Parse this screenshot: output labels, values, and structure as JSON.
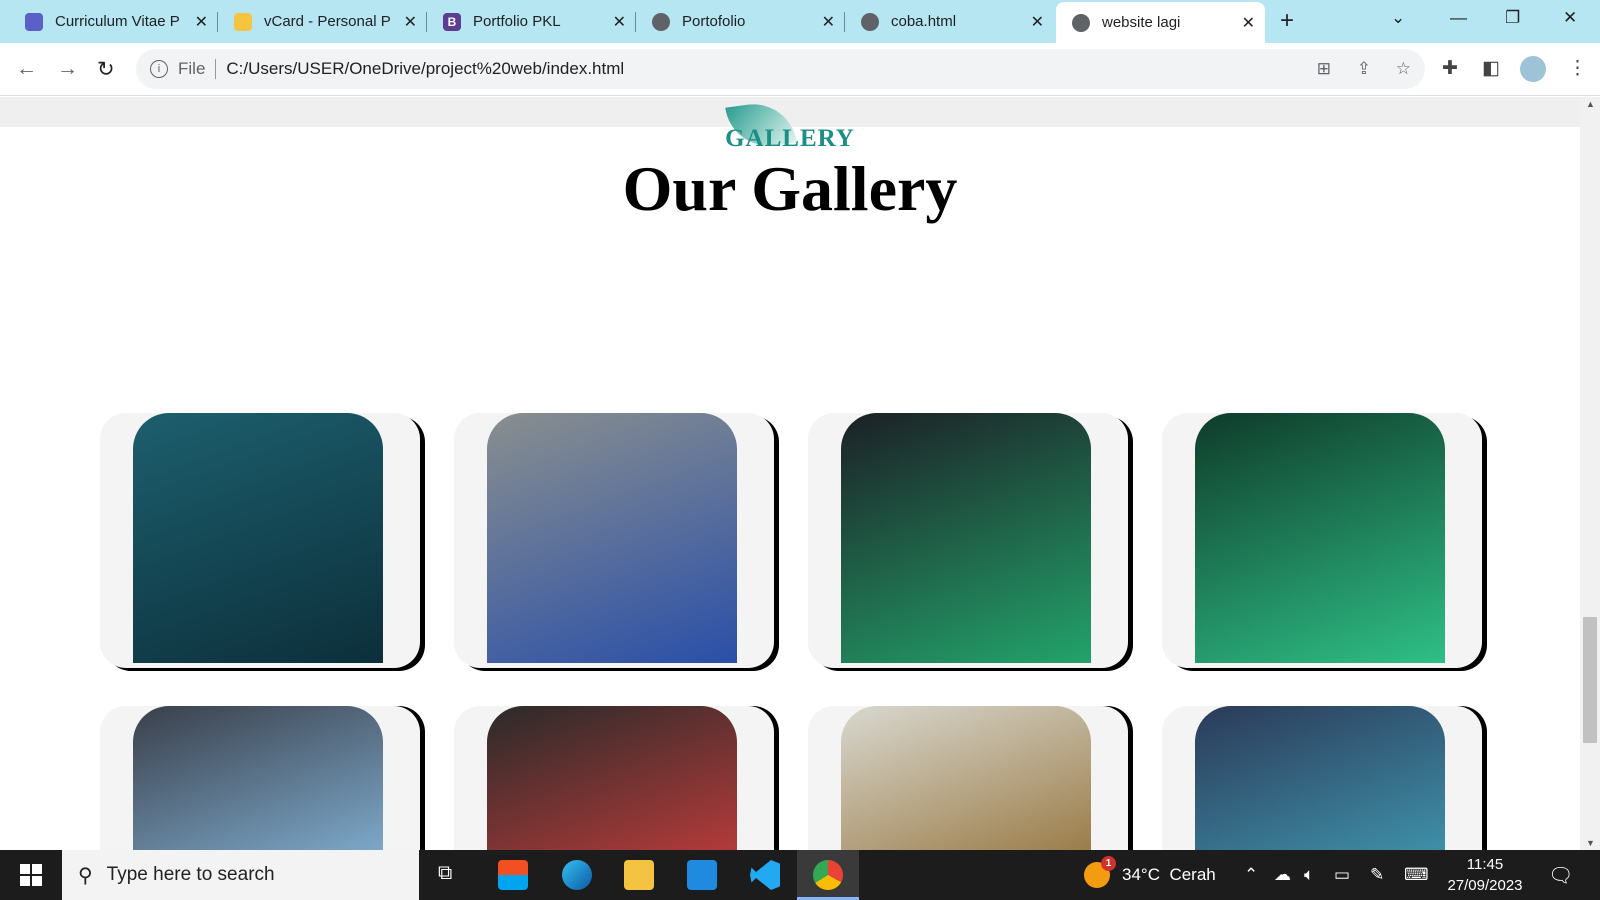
{
  "browser": {
    "tabs": [
      {
        "label": "Curriculum Vitae P",
        "icon": "cv-icon",
        "color": "#5b5fc7"
      },
      {
        "label": "vCard - Personal P",
        "icon": "vcard-icon",
        "color": "#f5c542"
      },
      {
        "label": "Portfolio PKL",
        "icon": "bootstrap-icon",
        "color": "#5d3d91"
      },
      {
        "label": "Portofolio",
        "icon": "globe-icon",
        "color": "#5f6368"
      },
      {
        "label": "coba.html",
        "icon": "globe-icon",
        "color": "#5f6368"
      },
      {
        "label": "website lagi",
        "icon": "globe-icon",
        "color": "#5f6368"
      }
    ],
    "new_tab": "+",
    "address": {
      "scheme_label": "File",
      "url": "C:/Users/USER/OneDrive/project%20web/index.html"
    }
  },
  "page": {
    "section_label": "GALLERY",
    "title": "Our Gallery",
    "gallery": [
      {
        "name": "futsal-action-1",
        "colors": [
          "#1d5f6e",
          "#0c2f3a"
        ]
      },
      {
        "name": "futsal-match-2",
        "colors": [
          "#8a8f8e",
          "#2a4fa8"
        ]
      },
      {
        "name": "futsal-women-3",
        "colors": [
          "#1c1f25",
          "#23a36b"
        ]
      },
      {
        "name": "futsal-match-4",
        "colors": [
          "#0f3b2a",
          "#2fbf86"
        ]
      },
      {
        "name": "futsal-women-5",
        "colors": [
          "#3a3f4a",
          "#7ca7c8"
        ]
      },
      {
        "name": "futsal-court-6",
        "colors": [
          "#2a2a2a",
          "#b33a3a"
        ]
      },
      {
        "name": "futsal-hall-7",
        "colors": [
          "#d8d8d0",
          "#9b7d4a"
        ]
      },
      {
        "name": "futsal-hall-8",
        "colors": [
          "#2b3a58",
          "#3f8fa8"
        ]
      }
    ]
  },
  "taskbar": {
    "search_placeholder": "Type here to search",
    "weather": {
      "temp": "34°C",
      "condition": "Cerah",
      "badge": "1"
    },
    "time": "11:45",
    "date": "27/09/2023"
  }
}
